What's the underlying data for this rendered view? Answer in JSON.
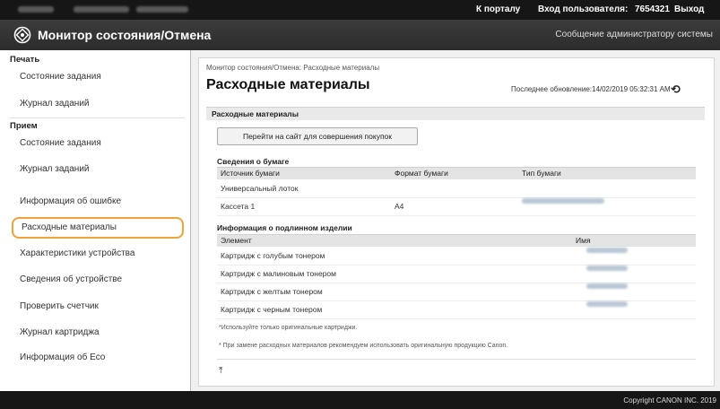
{
  "topbar": {
    "portal_link": "К порталу",
    "login_label": "Вход пользователя:",
    "user_id": "7654321",
    "logout_link": "Выход"
  },
  "header": {
    "app_title": "Монитор состояния/Отмена",
    "admin_message": "Сообщение администратору системы"
  },
  "sidebar": {
    "print_section": "Печать",
    "print_items": [
      "Состояние задания",
      "Журнал заданий"
    ],
    "receive_section": "Прием",
    "receive_items": [
      "Состояние задания",
      "Журнал заданий",
      "Информация об ошибке",
      "Расходные материалы",
      "Характеристики устройства",
      "Сведения об устройстве",
      "Проверить счетчик",
      "Журнал картриджа",
      "Информация об Eco"
    ],
    "selected_item": "Расходные материалы"
  },
  "main": {
    "breadcrumb": "Монитор состояния/Отмена: Расходные материалы",
    "page_title": "Расходные материалы",
    "last_update": "Последнее обновление:14/02/2019 05:32:31 AM",
    "section_title": "Расходные материалы",
    "shop_button": "Перейти на сайт для совершения покупок",
    "paper": {
      "title": "Сведения о бумаге",
      "columns": [
        "Источник бумаги",
        "Формат бумаги",
        "Тип бумаги"
      ],
      "rows": [
        [
          "Универсальный лоток",
          "",
          ""
        ],
        [
          "Кассета 1",
          "A4",
          ""
        ]
      ]
    },
    "consumables": {
      "title": "Информация о подлинном изделии",
      "columns": [
        "Элемент",
        "Имя"
      ],
      "rows": [
        "Картридж с голубым тонером",
        "Картридж с малиновым тонером",
        "Картридж с желтым тонером",
        "Картридж с черным тонером"
      ]
    },
    "note1": "*Используйте только оригинальные картриджи.",
    "note2": "* При замене расходных материалов рекомендуем использовать оригинальную продукцию Canon."
  },
  "footer": {
    "copyright": "Copyright CANON INC. 2019"
  },
  "colors": {
    "selection_outline": "#f1a33a",
    "header_bg": "#161616"
  }
}
